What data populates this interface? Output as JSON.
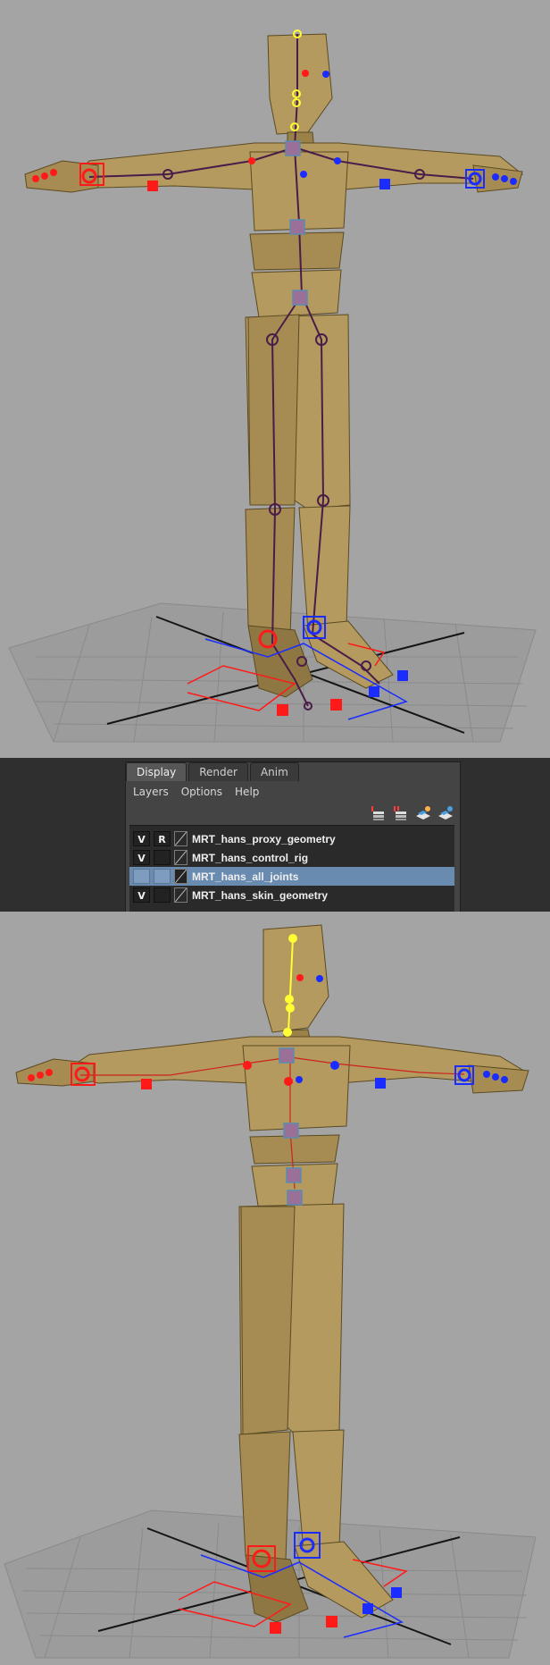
{
  "layer_editor": {
    "tabs": [
      {
        "label": "Display",
        "active": true
      },
      {
        "label": "Render",
        "active": false
      },
      {
        "label": "Anim",
        "active": false
      }
    ],
    "menu": [
      "Layers",
      "Options",
      "Help"
    ],
    "toolbar_icons": [
      "new-layer-from-selection-icon",
      "new-empty-layer-icon",
      "move-layer-up-icon",
      "move-layer-down-icon"
    ],
    "layers": [
      {
        "visible": "V",
        "display_type": "R",
        "name": "MRT_hans_proxy_geometry",
        "selected": false
      },
      {
        "visible": "V",
        "display_type": "",
        "name": "MRT_hans_control_rig",
        "selected": false
      },
      {
        "visible": "",
        "display_type": "",
        "name": "MRT_hans_all_joints",
        "selected": true
      },
      {
        "visible": "V",
        "display_type": "",
        "name": "MRT_hans_skin_geometry",
        "selected": false
      }
    ]
  },
  "colors": {
    "viewport_bg": "#a4a4a4",
    "body": "#b49a5e",
    "body_shade": "#8e7742",
    "left_controls": "#ff1a1a",
    "right_controls": "#1a2cff",
    "joints": "#4a1c4a",
    "spine_controls": "#9a6f98",
    "head_controls": "#ffff33",
    "selected_row": "#6a8bb0"
  }
}
